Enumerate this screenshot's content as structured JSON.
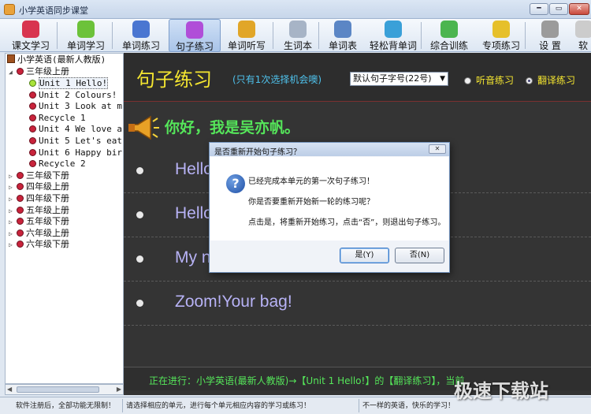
{
  "window": {
    "title": "小学英语同步课堂"
  },
  "toolbar": {
    "items": [
      {
        "label": "课文学习",
        "icon": "book-pencil-icon",
        "color": "#d8344f"
      },
      {
        "label": "单词学习",
        "icon": "flower-icon",
        "color": "#6cc23a"
      },
      {
        "label": "单词练习",
        "icon": "pencils-icon",
        "color": "#4a76d1"
      },
      {
        "label": "句子练习",
        "icon": "microphone-icon",
        "color": "#b04ed8"
      },
      {
        "label": "单词听写",
        "icon": "clock-icon",
        "color": "#e1a628"
      },
      {
        "label": "生词本",
        "icon": "notebook-icon",
        "color": "#a7b4c6"
      },
      {
        "label": "单词表",
        "icon": "list-book-icon",
        "color": "#5b86c5"
      },
      {
        "label": "轻松背单词",
        "icon": "people-icon",
        "color": "#3aa0d8"
      },
      {
        "label": "综合训练",
        "icon": "users-icon",
        "color": "#4bb54f"
      },
      {
        "label": "专项练习",
        "icon": "bee-icon",
        "color": "#e6c02a"
      },
      {
        "label": "设 置",
        "icon": "gear-icon",
        "color": "#9b9b9b"
      },
      {
        "label": "软",
        "icon": "more-icon",
        "color": "#cccccc"
      }
    ],
    "active_index": 3
  },
  "tree": {
    "root": "小学英语(最新人教版)",
    "grade_open": "三年级上册",
    "units": [
      "Unit 1 Hello!",
      "Unit 2 Colours!",
      "Unit 3 Look at m",
      "Recycle 1",
      "Unit 4 We love a",
      "Unit 5 Let's eat",
      "Unit 6 Happy bir",
      "Recycle 2"
    ],
    "selected_unit": 0,
    "other_grades": [
      "三年级下册",
      "四年级上册",
      "四年级下册",
      "五年级上册",
      "五年级下册",
      "六年级上册",
      "六年级下册"
    ]
  },
  "main": {
    "title": "句子练习",
    "hint": "(只有1次选择机会噢)",
    "font_select": "默认句子字号(22号)",
    "radio_listen": "听音练习",
    "radio_translate": "翻译练习",
    "radio_selected": "translate",
    "sentence": "你好，我是吴亦帆。",
    "options": [
      "Hello",
      "Hello",
      "My n",
      "Zoom!Your bag!"
    ],
    "progress_text": "正在进行：小学英语(最新人教版)→【Unit 1 Hello!】的【翻译练习】，当前"
  },
  "dialog": {
    "title": "是否重新开始句子练习？",
    "line1": "已经完成本单元的第一次句子练习！",
    "line2": "你是否要重新开始新一轮的练习呢？",
    "line3": "点击是，将重新开始练习，点击“否”，则退出句子练习。",
    "yes": "是(Y)",
    "no": "否(N)"
  },
  "status": {
    "s1": "软件注册后，全部功能无限制！",
    "s2": "请选择相应的单元，进行每个单元相应内容的学习或练习！",
    "s3": "不一样的英语，快乐的学习！"
  },
  "watermark": "极速下载站"
}
